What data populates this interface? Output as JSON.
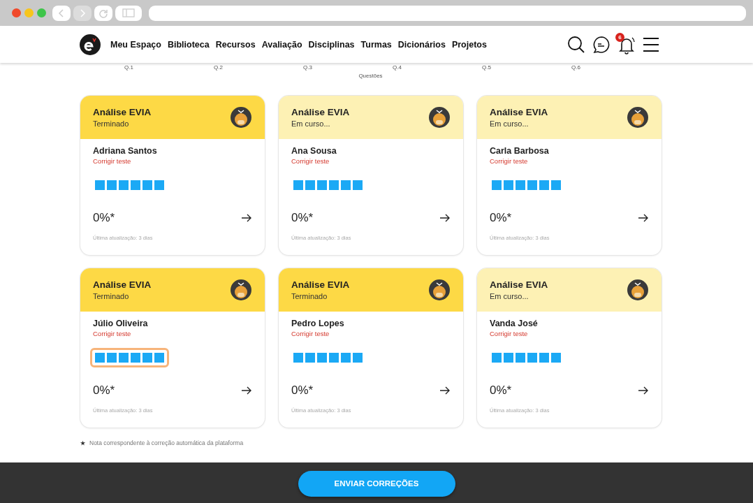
{
  "nav": {
    "items": [
      "Meu Espaço",
      "Biblioteca",
      "Recursos",
      "Avaliação",
      "Disciplinas",
      "Turmas",
      "Dicionários",
      "Projetos"
    ],
    "notification_count": "6"
  },
  "chart_axis": {
    "ticks": [
      "Q.1",
      "Q.2",
      "Q.3",
      "Q.4",
      "Q.5",
      "Q.6"
    ],
    "label": "Questões"
  },
  "cards": [
    {
      "title": "Análise EVIA",
      "status": "Terminado",
      "kind": "done",
      "student": "Adriana Santos",
      "action": "Corrigir teste",
      "highlighted": false,
      "score": "0%*",
      "updated": "Última atualização: 3 dias"
    },
    {
      "title": "Análise EVIA",
      "status": "Em curso...",
      "kind": "ongoing",
      "student": "Ana Sousa",
      "action": "Corrigir teste",
      "highlighted": false,
      "score": "0%*",
      "updated": "Última atualização: 3 dias"
    },
    {
      "title": "Análise EVIA",
      "status": "Em curso...",
      "kind": "ongoing",
      "student": "Carla Barbosa",
      "action": "Corrigir teste",
      "highlighted": false,
      "score": "0%*",
      "updated": "Última atualização: 3 dias"
    },
    {
      "title": "Análise EVIA",
      "status": "Terminado",
      "kind": "done",
      "student": "Júlio Oliveira",
      "action": "Corrigir teste",
      "highlighted": true,
      "score": "0%*",
      "updated": "Última atualização: 3 dias"
    },
    {
      "title": "Análise EVIA",
      "status": "Terminado",
      "kind": "done",
      "student": "Pedro Lopes",
      "action": "Corrigir teste",
      "highlighted": false,
      "score": "0%*",
      "updated": "Última atualização: 3 dias"
    },
    {
      "title": "Análise EVIA",
      "status": "Em curso...",
      "kind": "ongoing",
      "student": "Vanda José",
      "action": "Corrigir teste",
      "highlighted": false,
      "score": "0%*",
      "updated": "Última atualização: 3 dias"
    }
  ],
  "footnote": {
    "mark": "★",
    "text": "Nota correspondente à correção automática da plataforma"
  },
  "submit_button": "ENVIAR CORREÇÕES"
}
